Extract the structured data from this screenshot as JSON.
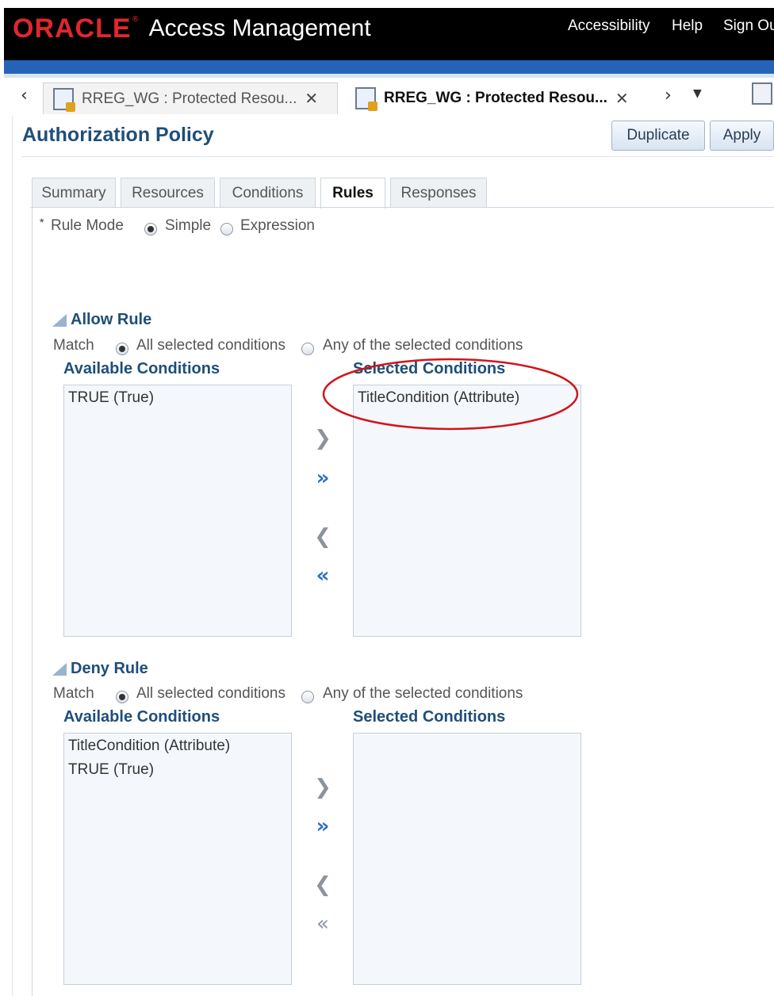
{
  "header": {
    "brand": "ORACLE",
    "product": "Access Management",
    "links": [
      "Accessibility",
      "Help",
      "Sign Ou"
    ]
  },
  "doc_tabs": [
    {
      "label": "RREG_WG : Protected Resou...",
      "active": false
    },
    {
      "label": "RREG_WG : Protected Resou...",
      "active": true
    }
  ],
  "page": {
    "title": "Authorization Policy",
    "buttons": {
      "duplicate": "Duplicate",
      "apply": "Apply"
    }
  },
  "sub_tabs": [
    "Summary",
    "Resources",
    "Conditions",
    "Rules",
    "Responses"
  ],
  "active_sub_tab": "Rules",
  "rule_mode": {
    "required_mark": "*",
    "label": "Rule Mode",
    "options": [
      "Simple",
      "Expression"
    ],
    "selected": "Simple"
  },
  "allow_rule": {
    "title": "Allow Rule",
    "match_label": "Match",
    "match_options": [
      "All selected conditions",
      "Any of the selected conditions"
    ],
    "match_selected": "All selected conditions",
    "available_header": "Available Conditions",
    "selected_header": "Selected Conditions",
    "available": [
      "TRUE (True)"
    ],
    "selected": [
      "TitleCondition (Attribute)"
    ]
  },
  "deny_rule": {
    "title": "Deny Rule",
    "match_label": "Match",
    "match_options": [
      "All selected conditions",
      "Any of the selected conditions"
    ],
    "match_selected": "All selected conditions",
    "available_header": "Available Conditions",
    "selected_header": "Selected Conditions",
    "available": [
      "TitleCondition (Attribute)",
      "TRUE (True)"
    ],
    "selected": []
  },
  "shuttle_icons": [
    "move-icon",
    "move-all-icon",
    "remove-icon",
    "remove-all-icon"
  ],
  "colors": {
    "header_bg": "#000000",
    "brand_red": "#e0262f",
    "accent_blue": "#2563b8",
    "heading_blue": "#1f4e79",
    "annotation_red": "#d0151c"
  }
}
